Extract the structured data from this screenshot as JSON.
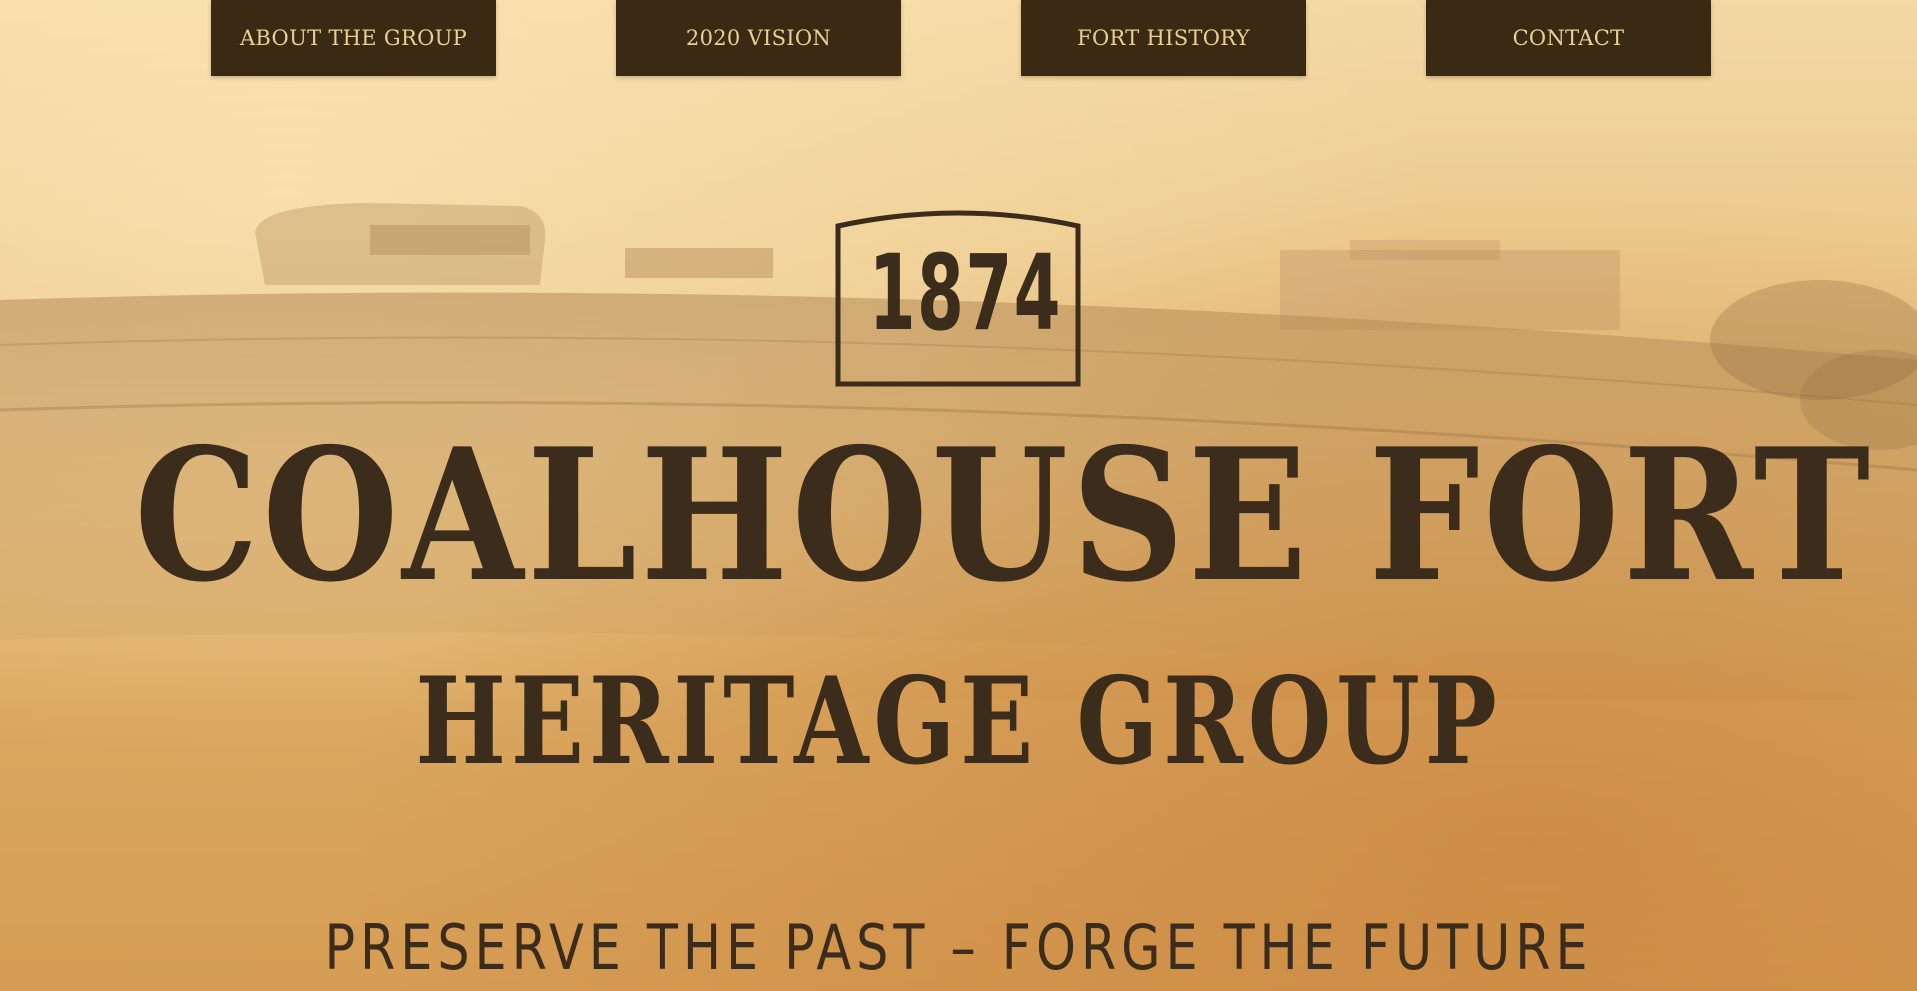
{
  "nav": {
    "items": [
      {
        "label": "ABOUT THE GROUP"
      },
      {
        "label": "2020 VISION"
      },
      {
        "label": "FORT HISTORY"
      },
      {
        "label": "CONTACT"
      }
    ]
  },
  "hero": {
    "year": "1874",
    "title": "COALHOUSE FORT",
    "subtitle": "HERITAGE GROUP",
    "tagline": "PRESERVE THE PAST – FORGE THE FUTURE"
  },
  "colors": {
    "nav_bg": "#3a2a14",
    "nav_text": "#e9cf95",
    "ink": "#3b2c1c",
    "paper": "#e9c384"
  }
}
